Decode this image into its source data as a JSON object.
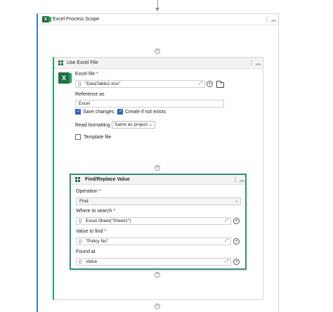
{
  "scope": {
    "title": "Excel Process Scope"
  },
  "use_excel_file": {
    "title": "Use Excel File",
    "excel_file_label": "Excel file",
    "excel_file_required": "*",
    "excel_file_value": "\"DataTable2.xlsx\"",
    "reference_label": "Reference as",
    "reference_value": "Excel",
    "save_changes_label": "Save changes",
    "save_changes_checked": true,
    "create_if_not_exists_label": "Create if not exists",
    "create_if_not_exists_checked": true,
    "read_formatting_label": "Read formatting",
    "read_formatting_value": "Same as project",
    "template_file_label": "Template file",
    "template_file_checked": false
  },
  "find_replace": {
    "title": "Find/Replace Value",
    "operation_label": "Operation",
    "operation_required": "*",
    "operation_value": "Find",
    "where_label": "Where to search",
    "where_required": "*",
    "where_value": "Excel.Sheet(\"Sheet1\")",
    "value_label": "Value to find",
    "value_required": "*",
    "value_value": "\"Policy No\"",
    "found_label": "Found at",
    "found_value": "Value"
  },
  "icons": {
    "excel_letter": "X",
    "kebab": "⋮",
    "collapse": "︽",
    "plus": "+",
    "curly": "{}",
    "expand": "⤢",
    "dropdown": "⌄"
  },
  "colors": {
    "scope_accent": "#3b7dd8",
    "use_file_accent": "#21a366",
    "find_border": "#3a8f7d",
    "excel_green": "#1e7145",
    "checkbox_blue": "#2a63c6"
  }
}
